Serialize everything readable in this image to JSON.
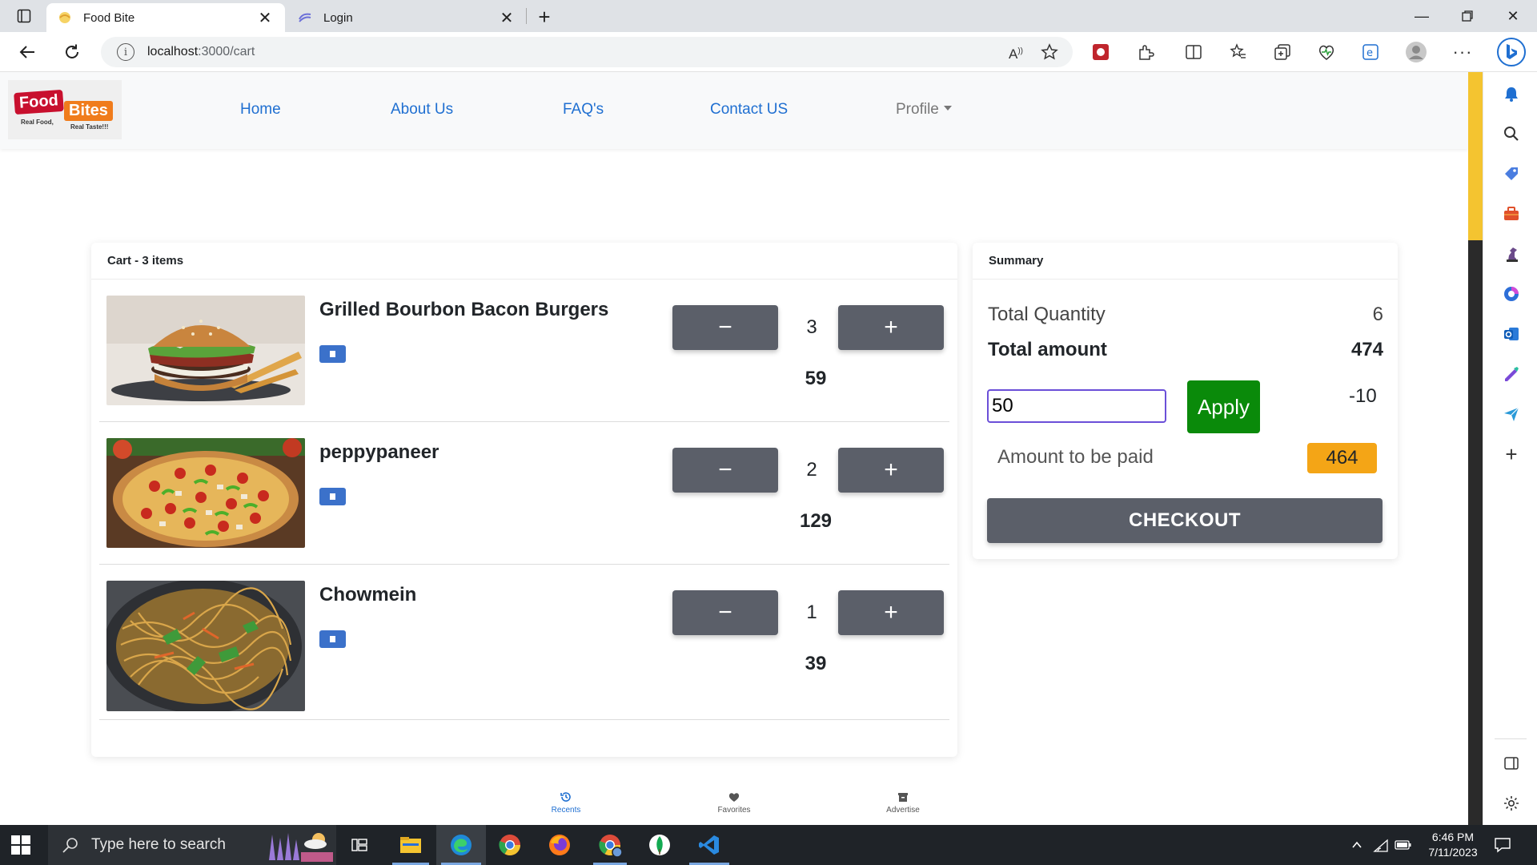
{
  "browser": {
    "tabs": [
      {
        "title": "Food Bite",
        "active": true
      },
      {
        "title": "Login",
        "active": false
      }
    ],
    "url_host": "localhost",
    "url_path": ":3000/cart"
  },
  "site": {
    "logo": {
      "food": "Food",
      "bites": "Bites",
      "tagline_left": "Real Food,",
      "tagline_right": "Real Taste!!!"
    },
    "nav": {
      "home": "Home",
      "about": "About Us",
      "faq": "FAQ's",
      "contact": "Contact US",
      "profile": "Profile"
    }
  },
  "cart": {
    "header": "Cart - 3 items",
    "items": [
      {
        "name": "Grilled Bourbon Bacon Burgers",
        "qty": "3",
        "price": "59",
        "image": "burger"
      },
      {
        "name": "peppypaneer",
        "qty": "2",
        "price": "129",
        "image": "pizza"
      },
      {
        "name": "Chowmein",
        "qty": "1",
        "price": "39",
        "image": "noodles"
      }
    ],
    "minus_label": "−",
    "plus_label": "+"
  },
  "summary": {
    "header": "Summary",
    "total_quantity_label": "Total Quantity",
    "total_quantity": "6",
    "total_amount_label": "Total amount",
    "total_amount": "474",
    "coupon_value": "50",
    "apply_label": "Apply",
    "discount": "-10",
    "amount_to_pay_label": "Amount to be paid",
    "amount_to_pay": "464",
    "checkout_label": "CHECKOUT"
  },
  "bottom_nav": {
    "recents": "Recents",
    "favorites": "Favorites",
    "advertise": "Advertise"
  },
  "taskbar": {
    "search_placeholder": "Type here to search",
    "time": "6:46 PM",
    "date": "7/11/2023"
  },
  "colors": {
    "accent": "#1f6fd1",
    "button_gray": "#5b5f69",
    "apply_green": "#0a8a0a",
    "amount_badge": "#f4a516",
    "coupon_border": "#6b4fd8"
  }
}
